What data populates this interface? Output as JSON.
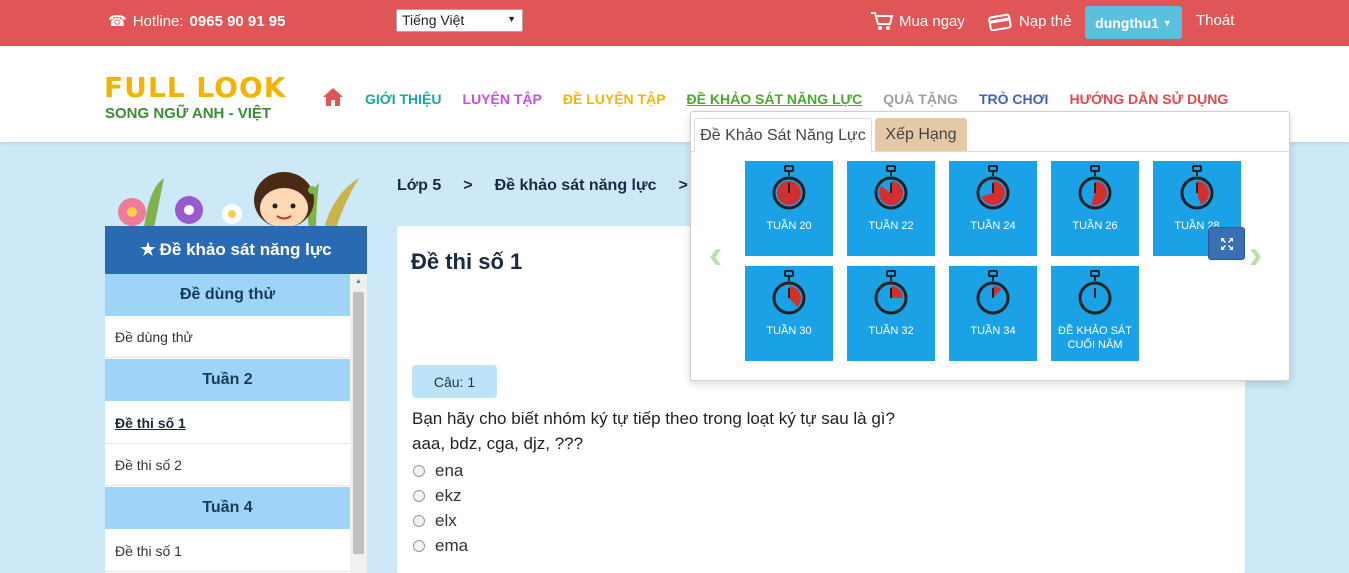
{
  "topbar": {
    "hotline_label": "Hotline:",
    "hotline_number": "0965 90 91 95",
    "language": "Tiếng Việt",
    "buy_label": "Mua ngay",
    "topup_label": "Nạp thẻ",
    "username": "dungthu1",
    "logout_label": "Thoát"
  },
  "logo": {
    "title": "FULL LOOK",
    "subtitle": "SONG NGỮ ANH - VIỆT"
  },
  "nav": [
    {
      "label": "GIỚI THIỆU",
      "color": "#1aa7a0"
    },
    {
      "label": "LUYỆN TẬP",
      "color": "#c84fe6"
    },
    {
      "label": "ĐỀ LUYỆN TẬP",
      "color": "#f2b705"
    },
    {
      "label": "ĐỀ KHẢO SÁT NĂNG LỰC",
      "color": "#4aa82c"
    },
    {
      "label": "QUÀ TẶNG",
      "color": "#9aa2a8"
    },
    {
      "label": "TRÒ CHƠI",
      "color": "#3f62c4"
    },
    {
      "label": "HƯỚNG DẪN SỬ DỤNG",
      "color": "#e04a4a"
    }
  ],
  "sidebar": {
    "title": "Đề khảo sát năng lực",
    "groups": [
      {
        "week": "Đề dùng thử",
        "items": [
          "Đề dùng thử"
        ]
      },
      {
        "week": "Tuần 2",
        "items": [
          "Đề thi số 1",
          "Đề thi số 2"
        ]
      },
      {
        "week": "Tuần 4",
        "items": [
          "Đề thi số 1"
        ]
      }
    ]
  },
  "breadcrumb": {
    "grade": "Lớp 5",
    "sep": ">",
    "section": "Đề khảo sát năng lực",
    "sep2": ">"
  },
  "exam": {
    "title": "Đề thi số 1",
    "question_badge": "Câu: 1",
    "question_line1": "Bạn hãy cho biết nhóm ký tự tiếp theo trong loạt ký tự sau là gì?",
    "question_line2": "aaa, bdz, cga, djz, ???",
    "options": [
      "ena",
      "ekz",
      "elx",
      "ema"
    ]
  },
  "popup": {
    "tab_active": "Đề Khảo Sát Năng Lực",
    "tab_other": "Xếp Hạng",
    "tiles": [
      {
        "label": "TUẦN 20",
        "fill": 1.0
      },
      {
        "label": "TUẦN 22",
        "fill": 0.85
      },
      {
        "label": "TUẦN 24",
        "fill": 0.7
      },
      {
        "label": "TUẦN 26",
        "fill": 0.55
      },
      {
        "label": "TUẦN 28",
        "fill": 0.45
      },
      {
        "label": "TUẦN 30",
        "fill": 0.38
      },
      {
        "label": "TUẦN 32",
        "fill": 0.25
      },
      {
        "label": "TUẦN 34",
        "fill": 0.12
      },
      {
        "label": "ĐỀ KHẢO SÁT CUỐI NĂM",
        "fill": 0.0
      }
    ]
  },
  "colors": {
    "topbar": "#e05555",
    "accent": "#1ba2e6",
    "sidebar_head": "#2a6ab3"
  }
}
